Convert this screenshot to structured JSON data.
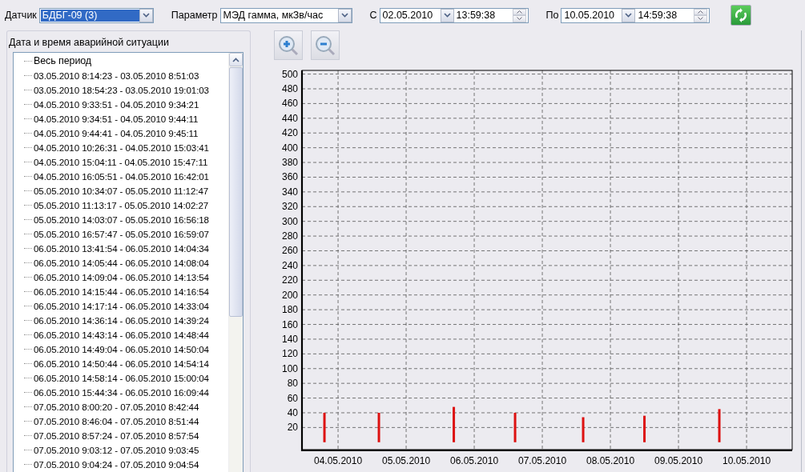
{
  "toolbar": {
    "sensor": {
      "label": "Датчик",
      "value": "БДБГ-09 (3)",
      "highlighted": true
    },
    "parameter": {
      "label": "Параметр",
      "value": "МЭД гамма, мкЗв/час",
      "highlighted": false
    },
    "from": {
      "label": "С",
      "date": "02.05.2010",
      "time": "13:59:38"
    },
    "to": {
      "label": "По",
      "date": "10.05.2010",
      "time": "14:59:38"
    }
  },
  "events": {
    "title": "Дата и время аварийной ситуации",
    "items": [
      "Весь период",
      "03.05.2010 8:14:23 - 03.05.2010 8:51:03",
      "03.05.2010 18:54:23 - 03.05.2010 19:01:03",
      "04.05.2010 9:33:51 - 04.05.2010 9:34:21",
      "04.05.2010 9:34:51 - 04.05.2010 9:44:11",
      "04.05.2010 9:44:41 - 04.05.2010 9:45:11",
      "04.05.2010 10:26:31 - 04.05.2010 15:03:41",
      "04.05.2010 15:04:11 - 04.05.2010 15:47:11",
      "04.05.2010 16:05:51 - 04.05.2010 16:42:01",
      "05.05.2010 10:34:07 - 05.05.2010 11:12:47",
      "05.05.2010 11:13:17 - 05.05.2010 14:02:27",
      "05.05.2010 14:03:07 - 05.05.2010 16:56:18",
      "05.05.2010 16:57:47 - 05.05.2010 16:59:07",
      "06.05.2010 13:41:54 - 06.05.2010 14:04:34",
      "06.05.2010 14:05:44 - 06.05.2010 14:08:04",
      "06.05.2010 14:09:04 - 06.05.2010 14:13:54",
      "06.05.2010 14:15:44 - 06.05.2010 14:16:54",
      "06.05.2010 14:17:14 - 06.05.2010 14:33:04",
      "06.05.2010 14:36:14 - 06.05.2010 14:39:24",
      "06.05.2010 14:43:14 - 06.05.2010 14:48:44",
      "06.05.2010 14:49:04 - 06.05.2010 14:50:04",
      "06.05.2010 14:50:44 - 06.05.2010 14:54:14",
      "06.05.2010 14:58:14 - 06.05.2010 15:00:04",
      "06.05.2010 15:44:34 - 06.05.2010 16:09:44",
      "07.05.2010 8:00:20 - 07.05.2010 8:42:44",
      "07.05.2010 8:46:04 - 07.05.2010 8:51:44",
      "07.05.2010 8:57:24 - 07.05.2010 8:57:54",
      "07.05.2010 9:03:12 - 07.05.2010 9:03:45",
      "07.05.2010 9:04:24 - 07.05.2010 9:04:54"
    ]
  },
  "chart": {
    "chart_data": {
      "type": "bar",
      "categories": [
        null,
        null,
        null,
        null,
        null,
        "04.05.2010",
        null,
        null,
        null,
        null,
        null,
        null,
        null,
        null,
        null,
        "05.05.2010",
        null,
        null,
        null,
        null,
        null,
        null,
        null,
        null,
        null,
        "06.05.2010",
        null,
        null,
        null,
        null,
        null,
        null,
        null,
        null,
        null,
        "07.05.2010",
        null,
        null,
        null,
        null,
        null,
        null,
        null,
        null,
        null,
        "08.05.2010",
        null,
        null,
        null,
        null,
        null,
        null,
        null,
        null,
        null,
        "09.05.2010",
        null,
        null,
        null,
        null,
        null,
        null,
        null,
        null,
        null,
        "10.05.2010",
        null,
        null,
        null,
        null,
        null,
        null
      ],
      "series": [
        {
          "color": "#dd1111",
          "values": [
            null,
            null,
            null,
            40,
            null,
            null,
            null,
            null,
            null,
            null,
            null,
            40,
            null,
            null,
            null,
            null,
            null,
            null,
            null,
            null,
            null,
            null,
            48,
            null,
            null,
            null,
            null,
            null,
            null,
            null,
            null,
            40,
            null,
            null,
            null,
            null,
            null,
            null,
            null,
            null,
            null,
            34,
            null,
            null,
            null,
            null,
            null,
            null,
            null,
            null,
            36,
            null,
            null,
            null,
            null,
            null,
            null,
            null,
            null,
            null,
            null,
            45,
            null,
            null,
            null,
            null,
            null,
            null,
            null,
            null,
            null,
            null
          ]
        }
      ],
      "ylim": [
        -10,
        505
      ],
      "grid": true,
      "yticks": [
        20,
        40,
        60,
        80,
        100,
        120,
        140,
        160,
        180,
        200,
        220,
        240,
        260,
        280,
        300,
        320,
        340,
        360,
        380,
        400,
        420,
        440,
        460,
        480,
        500
      ]
    }
  }
}
